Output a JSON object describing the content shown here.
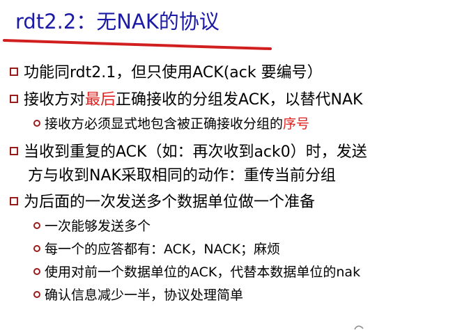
{
  "slide": {
    "title": "rdt2.2：无NAK的协议",
    "bullets": [
      {
        "text": "功能同rdt2.1，但只使用ACK(ack 要编号）"
      },
      {
        "pre": "接收方对",
        "highlight": "最后",
        "post": "正确接收的分组发ACK，以替代NAK"
      },
      {
        "pre": "接收方必须显式地包含被正确接收分组的",
        "highlight": "序号"
      },
      {
        "line1": "当收到重复的ACK（如：再次收到ack0）时，发送",
        "line2": "方与收到NAK采取相同的动作：重传当前分组"
      },
      {
        "text": "为后面的一次发送多个数据单位做一个准备"
      },
      {
        "text": "一次能够发送多个"
      },
      {
        "text": "每一个的应答都有：ACK，NACK；麻烦"
      },
      {
        "text": "使用对前一个数据单位的ACK，代替本数据单位的nak"
      },
      {
        "text": "确认信息减少一半，协议处理简单"
      }
    ]
  },
  "colors": {
    "title": "#1a1aa6",
    "underline": "#d11f1f",
    "bullet_marker": "#9b1a1a",
    "highlight": "#e01e1e"
  }
}
